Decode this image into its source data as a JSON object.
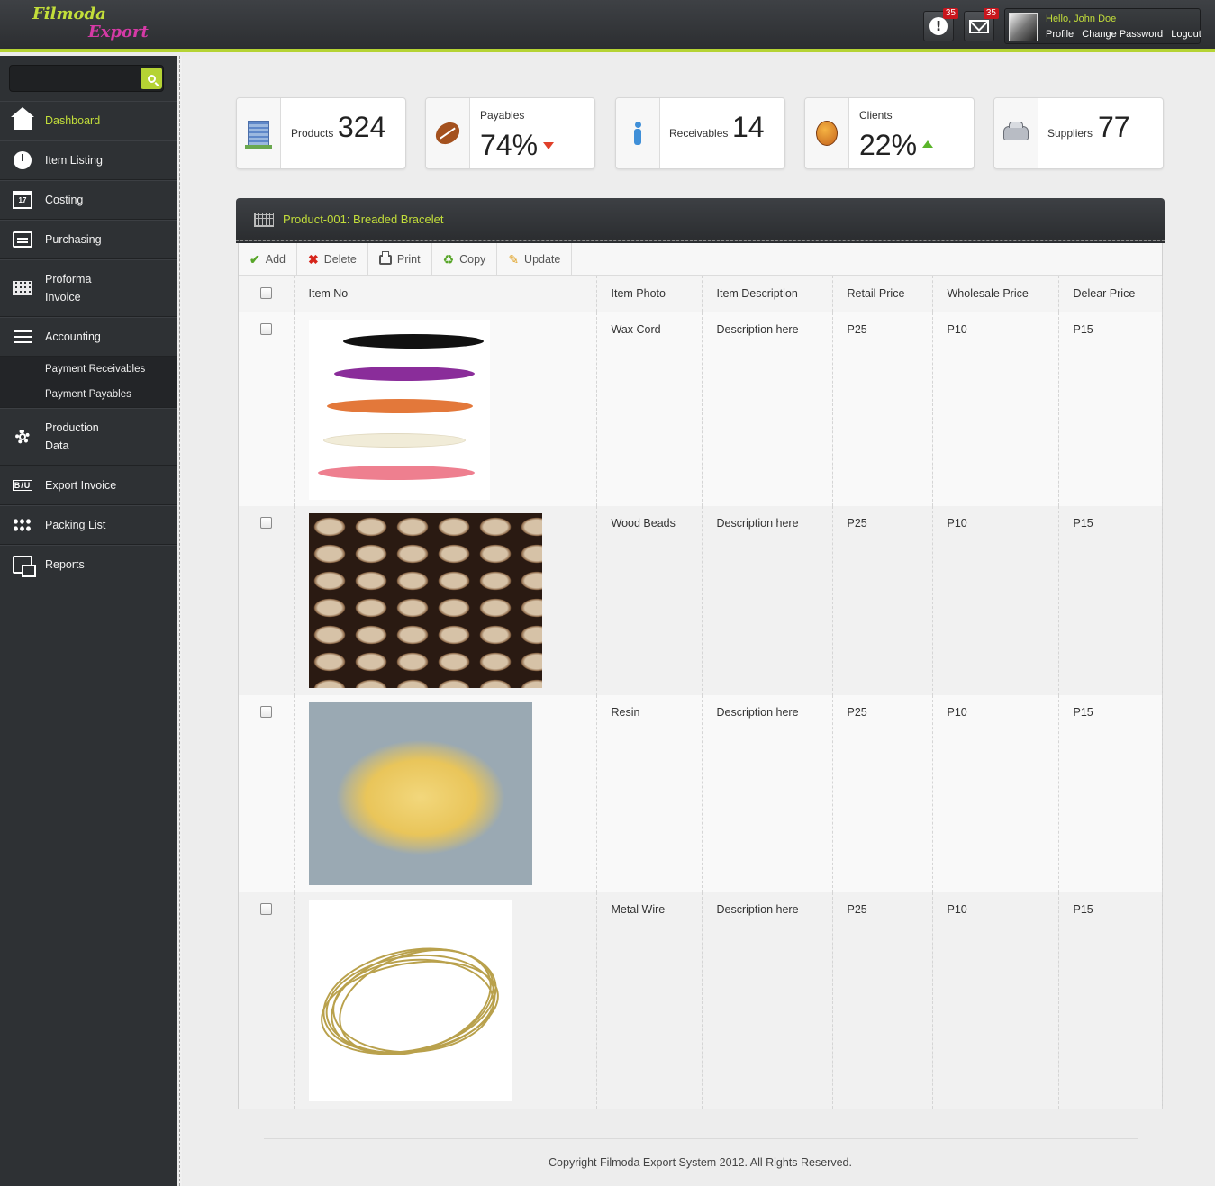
{
  "brand": {
    "line1": "Filmoda",
    "line2": "Export"
  },
  "topbar": {
    "alerts_count": "35",
    "messages_count": "35",
    "greeting": "Hello, John Doe",
    "links": [
      "Profile",
      "Change Password",
      "Logout"
    ]
  },
  "sidebar": {
    "search_placeholder": "",
    "items": [
      {
        "label": "Dashboard",
        "icon": "home-icon",
        "active": true
      },
      {
        "label": "Item Listing",
        "icon": "clock-icon"
      },
      {
        "label": "Costing",
        "icon": "calendar-icon",
        "icon_text": "17"
      },
      {
        "label": "Purchasing",
        "icon": "box-icon"
      },
      {
        "label": "Proforma",
        "label2": "Invoice",
        "icon": "grid-icon"
      },
      {
        "label": "Accounting",
        "icon": "lines-icon"
      },
      {
        "label": "Production",
        "label2": "Data",
        "icon": "gear-icon"
      },
      {
        "label": "Export Invoice",
        "icon": "biu-icon",
        "icon_text": "B/U"
      },
      {
        "label": "Packing List",
        "icon": "dots-icon"
      },
      {
        "label": "Reports",
        "icon": "report-icon"
      }
    ],
    "accounting_sub": [
      "Payment Receivables",
      "Payment Payables"
    ]
  },
  "stats": [
    {
      "label": "Products",
      "value": "324",
      "icon": "building-icon"
    },
    {
      "label": "Payables",
      "value": "74%",
      "trend": "down",
      "icon": "football-icon"
    },
    {
      "label": "Receivables",
      "value": "14",
      "icon": "person-icon"
    },
    {
      "label": "Clients",
      "value": "22%",
      "trend": "up",
      "icon": "bug-icon"
    },
    {
      "label": "Suppliers",
      "value": "77",
      "icon": "car-icon"
    }
  ],
  "panel": {
    "title": "Product-001: Breaded Bracelet",
    "toolbar": [
      "Add",
      "Delete",
      "Print",
      "Copy",
      "Update"
    ],
    "columns": [
      "Item No",
      "Item Photo",
      "Item Description",
      "Retail Price",
      "Wholesale Price",
      "Delear Price"
    ],
    "rows": [
      {
        "name": "Wax Cord",
        "description": "Description here",
        "retail": "P25",
        "wholesale": "P10",
        "dealer": "P15"
      },
      {
        "name": "Wood Beads",
        "description": "Description here",
        "retail": "P25",
        "wholesale": "P10",
        "dealer": "P15"
      },
      {
        "name": "Resin",
        "description": "Description here",
        "retail": "P25",
        "wholesale": "P10",
        "dealer": "P15"
      },
      {
        "name": "Metal Wire",
        "description": "Description here",
        "retail": "P25",
        "wholesale": "P10",
        "dealer": "P15"
      }
    ]
  },
  "footer": {
    "text": "Copyright Filmoda Export System 2012. All Rights Reserved."
  },
  "colors": {
    "accent": "#b5d334",
    "brand_pink": "#d63aa6",
    "sidebar_bg": "#2e3134",
    "badge_red": "#c8161d"
  }
}
